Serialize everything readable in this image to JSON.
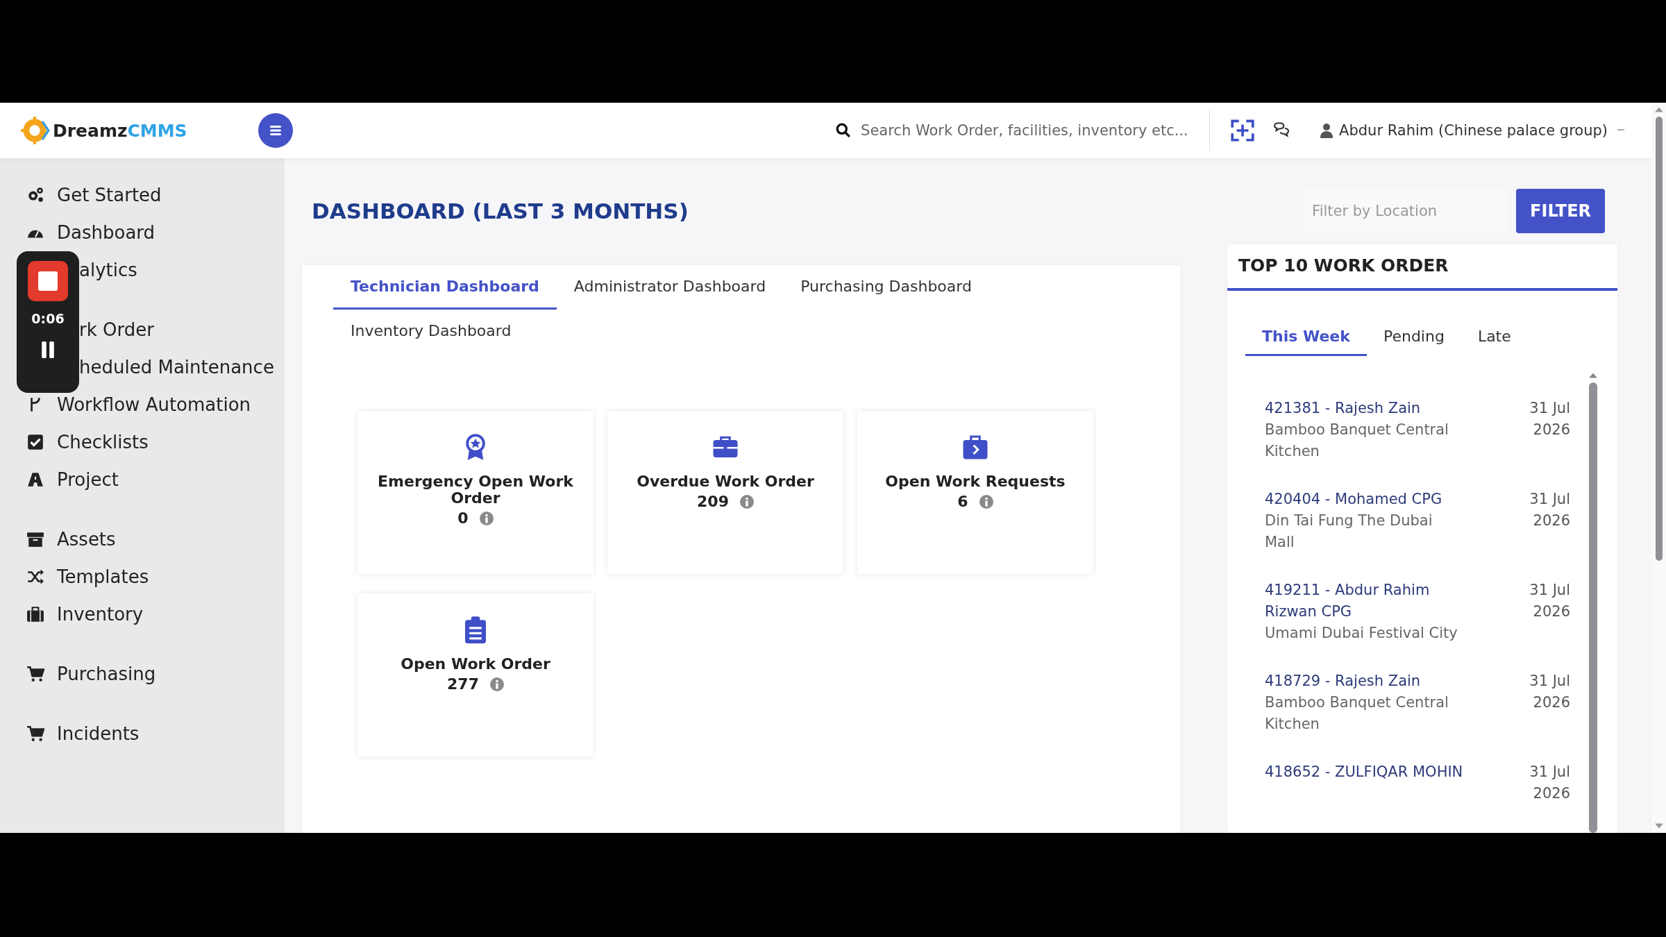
{
  "header": {
    "logo_text": "Dreamz",
    "logo_accent": "CMMS",
    "search": {
      "placeholder": "Search Work Order, facilities, inventory etc..."
    },
    "user": "Abdur Rahim (Chinese palace group)"
  },
  "sidebar": {
    "items": [
      {
        "label": "Get Started"
      },
      {
        "label": "Dashboard"
      },
      {
        "label": "alytics"
      },
      {
        "label": "rk Order"
      },
      {
        "label": "heduled Maintenance"
      },
      {
        "label": "Workflow Automation"
      },
      {
        "label": "Checklists"
      },
      {
        "label": "Project"
      },
      {
        "label": "Assets"
      },
      {
        "label": "Templates"
      },
      {
        "label": "Inventory"
      },
      {
        "label": "Purchasing"
      },
      {
        "label": "Incidents"
      }
    ]
  },
  "recorder": {
    "time": "0:06"
  },
  "page": {
    "title": "DASHBOARD (LAST 3 MONTHS)",
    "filter": {
      "placeholder": "Filter by Location",
      "button": "FILTER"
    }
  },
  "tabs": [
    {
      "label": "Technician Dashboard",
      "selected": true
    },
    {
      "label": "Administrator Dashboard",
      "selected": false
    },
    {
      "label": "Purchasing Dashboard",
      "selected": false
    },
    {
      "label": "Inventory Dashboard",
      "selected": false
    }
  ],
  "stats": [
    {
      "title": "Emergency Open Work Order",
      "value": "0"
    },
    {
      "title": "Overdue Work Order",
      "value": "209"
    },
    {
      "title": "Open Work Requests",
      "value": "6"
    },
    {
      "title": "Open Work Order",
      "value": "277"
    }
  ],
  "top_orders": {
    "title": "TOP 10 WORK ORDER",
    "tabs": [
      {
        "label": "This Week",
        "selected": true
      },
      {
        "label": "Pending",
        "selected": false
      },
      {
        "label": "Late",
        "selected": false
      }
    ],
    "items": [
      {
        "title": "421381 - Rajesh Zain",
        "location": "Bamboo Banquet Central Kitchen",
        "date": "31 Jul 2026"
      },
      {
        "title": "420404 - Mohamed CPG",
        "location": "Din Tai Fung The Dubai Mall",
        "date": "31 Jul 2026"
      },
      {
        "title": "419211 - Abdur Rahim Rizwan CPG",
        "location": "Umami Dubai Festival City",
        "date": "31 Jul 2026"
      },
      {
        "title": "418729 - Rajesh Zain",
        "location": "Bamboo Banquet Central Kitchen",
        "date": "31 Jul 2026"
      },
      {
        "title": "418652 - ZULFIQAR MOHIN",
        "date": "31 Jul 2026"
      }
    ]
  }
}
